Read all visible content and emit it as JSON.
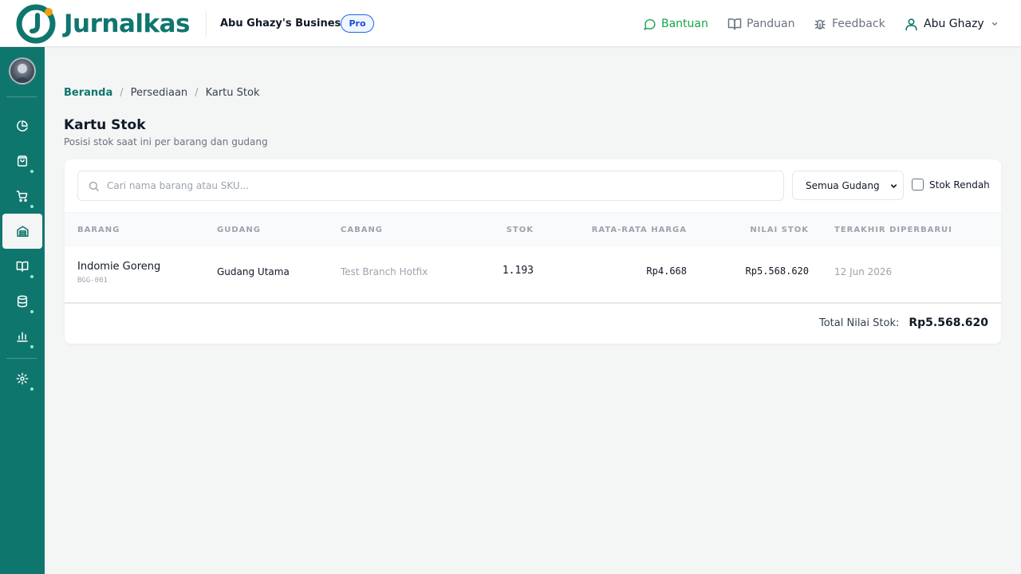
{
  "header": {
    "brand": "Jurnalkas",
    "business_name": "Abu Ghazy's Business",
    "plan_badge": "Pro",
    "nav": {
      "help": "Bantuan",
      "guide": "Panduan",
      "feedback": "Feedback",
      "user": "Abu Ghazy"
    }
  },
  "sidebar": {
    "items": [
      {
        "icon": "pie-chart-icon",
        "active": false,
        "dot": false
      },
      {
        "icon": "shopping-bag-icon",
        "active": false,
        "dot": true
      },
      {
        "icon": "cart-icon",
        "active": false,
        "dot": true
      },
      {
        "icon": "inventory-icon",
        "active": true,
        "dot": false
      },
      {
        "icon": "book-icon",
        "active": false,
        "dot": true
      },
      {
        "icon": "database-icon",
        "active": false,
        "dot": true
      },
      {
        "icon": "bar-chart-icon",
        "active": false,
        "dot": true
      },
      {
        "icon": "settings-icon",
        "active": false,
        "dot": true
      }
    ]
  },
  "breadcrumb": {
    "home": "Beranda",
    "section": "Persediaan",
    "current": "Kartu Stok",
    "separator": "/"
  },
  "page": {
    "title": "Kartu Stok",
    "subtitle": "Posisi stok saat ini per barang dan gudang"
  },
  "filters": {
    "search_placeholder": "Cari nama barang atau SKU...",
    "warehouse_selected": "Semua Gudang",
    "low_stock_label": "Stok Rendah",
    "low_stock_checked": false
  },
  "table": {
    "columns": [
      "BARANG",
      "GUDANG",
      "CABANG",
      "STOK",
      "RATA-RATA HARGA",
      "NILAI STOK",
      "TERAKHIR DIPERBARUI"
    ],
    "rows": [
      {
        "item": "Indomie Goreng",
        "sku": "BGG-001",
        "warehouse": "Gudang Utama",
        "branch": "Test Branch Hotfix",
        "stock": "1.193",
        "avg_price": "Rp4.668",
        "stock_value": "Rp5.568.620",
        "updated": "12 Jun 2026"
      }
    ]
  },
  "footer": {
    "total_label": "Total Nilai Stok:",
    "total_value": "Rp5.568.620"
  },
  "colors": {
    "brand": "#0f766e",
    "help_link": "#16a34a",
    "badge": "#1d4ed8"
  }
}
